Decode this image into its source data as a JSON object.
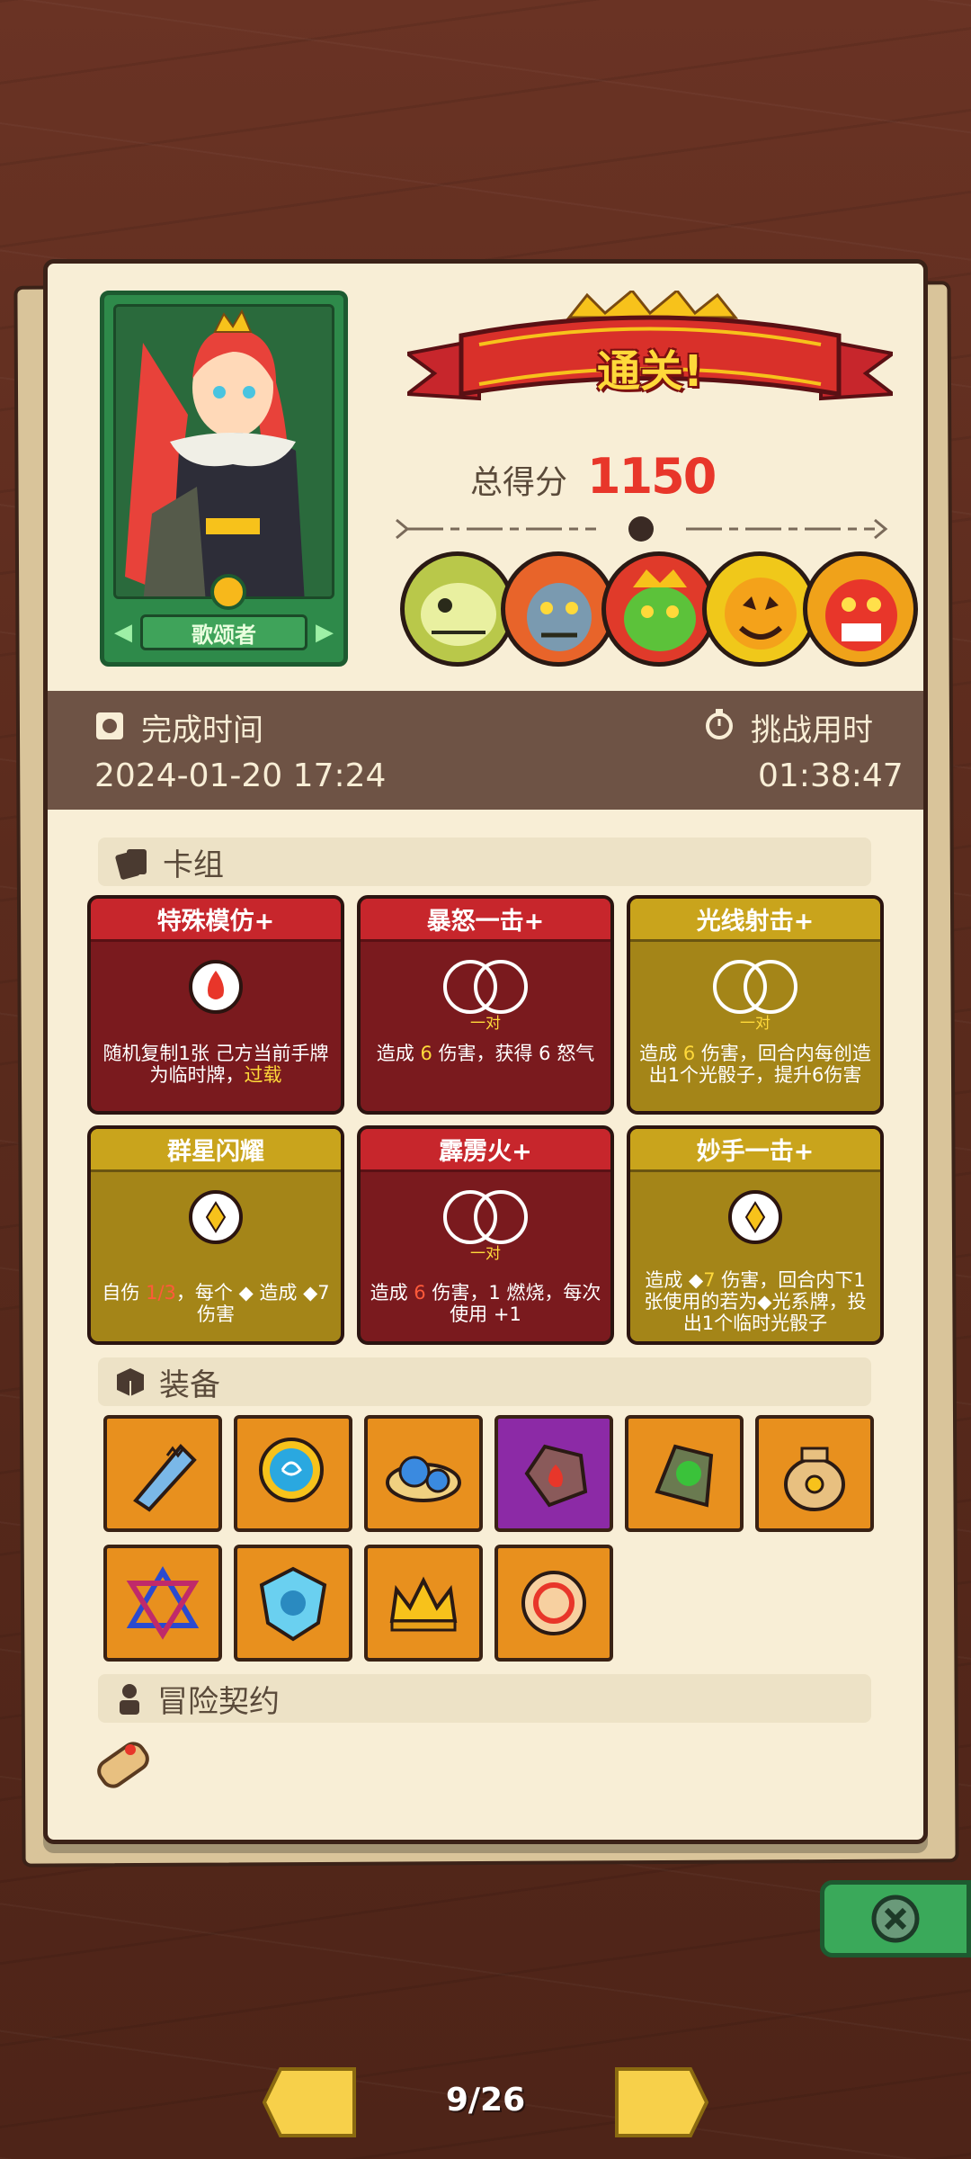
{
  "hero": {
    "name": "歌颂者"
  },
  "result": {
    "banner": "通关!",
    "score_label": "总得分",
    "score_value": "1150"
  },
  "stats": {
    "complete_time_label": "完成时间",
    "complete_time_value": "2024-01-20 17:24",
    "challenge_time_label": "挑战用时",
    "challenge_time_value": "01:38:47"
  },
  "deck": {
    "title": "卡组",
    "cards": [
      {
        "title": "特殊模仿+",
        "tag": "",
        "desc_a": "随机复制1张 己方当前手牌为临时牌，",
        "desc_hl": "过载",
        "desc_b": ""
      },
      {
        "title": "暴怒一击+",
        "tag": "一对",
        "desc_a": "造成 ",
        "desc_hl": "6",
        "desc_b": " 伤害，获得 6 怒气"
      },
      {
        "title": "光线射击+",
        "tag": "一对",
        "desc_a": "造成 ",
        "desc_hl": "6",
        "desc_b": " 伤害，回合内每创造出1个光骰子，提升6伤害"
      },
      {
        "title": "群星闪耀",
        "tag": "",
        "desc_a": "自伤 ",
        "desc_hl": "1/3",
        "desc_b": "，每个 ◆ 造成 ◆7 伤害"
      },
      {
        "title": "霹雳火+",
        "tag": "一对",
        "desc_a": "造成 ",
        "desc_hl": "6",
        "desc_b": " 伤害，1 燃烧，每次使用 +1"
      },
      {
        "title": "妙手一击+",
        "tag": "",
        "desc_a": "造成 ◆",
        "desc_hl": "7",
        "desc_b": " 伤害，回合内下1张使用的若为◆光系牌，投出1个临时光骰子"
      }
    ]
  },
  "equipment": {
    "title": "装备"
  },
  "contract": {
    "title": "冒险契约"
  },
  "pager": {
    "current": "9/26"
  },
  "colors": {
    "accent_red": "#c7262c",
    "accent_gold": "#c9a41c",
    "score": "#e8362a"
  },
  "icons": [
    "stamp-icon",
    "stopwatch-icon",
    "cards-icon",
    "box-icon",
    "seal-icon",
    "scroll-icon",
    "close-icon",
    "prev-page-icon",
    "next-page-icon"
  ]
}
